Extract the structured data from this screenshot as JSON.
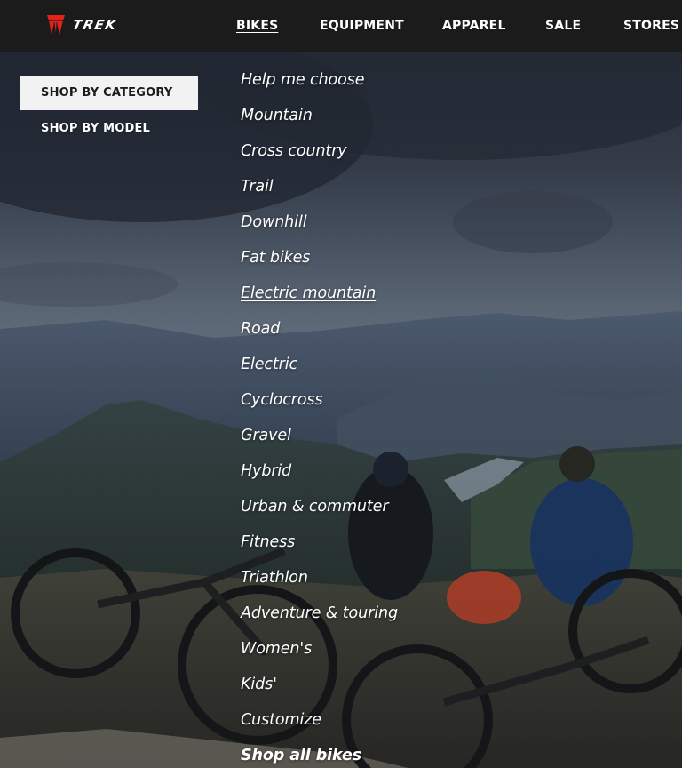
{
  "header": {
    "logo_text": "TREK",
    "logo_icon": "trek-logo-icon",
    "brand_color": "#e2231a",
    "nav": [
      {
        "label": "BIKES",
        "active": true
      },
      {
        "label": "EQUIPMENT",
        "active": false
      },
      {
        "label": "APPAREL",
        "active": false
      },
      {
        "label": "SALE",
        "active": false
      },
      {
        "label": "STORES",
        "active": false
      }
    ]
  },
  "menu": {
    "tabs": [
      {
        "label": "SHOP BY CATEGORY",
        "selected": true
      },
      {
        "label": "SHOP BY MODEL",
        "selected": false
      }
    ],
    "categories": [
      "Help me choose",
      "Mountain",
      "Cross country",
      "Trail",
      "Downhill",
      "Fat bikes",
      "Electric mountain",
      "Road",
      "Electric",
      "Cyclocross",
      "Gravel",
      "Hybrid",
      "Urban & commuter",
      "Fitness",
      "Triathlon",
      "Adventure & touring",
      "Women's",
      "Kids'",
      "Customize",
      "Shop all bikes"
    ],
    "hovered_category": "Electric mountain"
  },
  "background": {
    "description_icon": "mountain-bike-scene-image"
  }
}
